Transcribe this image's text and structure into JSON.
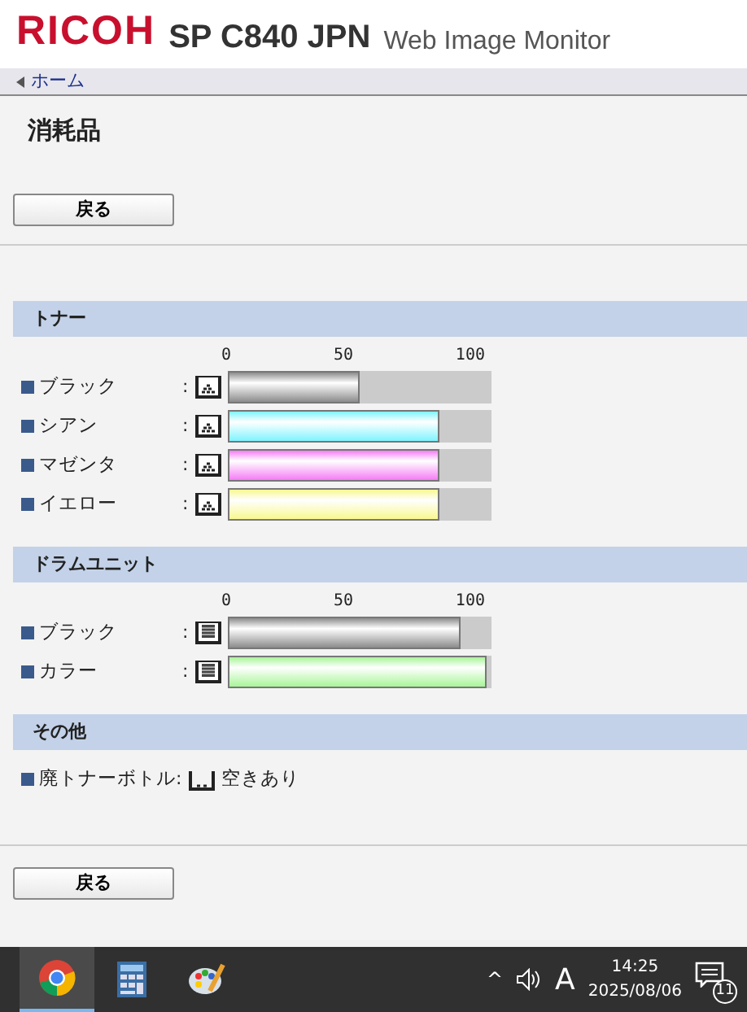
{
  "header": {
    "brand": "RICOH",
    "model": "SP C840 JPN",
    "product": "Web Image Monitor"
  },
  "breadcrumb": {
    "label": "ホーム"
  },
  "title": "消耗品",
  "top_button": {
    "label": "戻る"
  },
  "sections": [
    {
      "title": "トナー",
      "kind": "toner",
      "scale": [
        "0",
        "50",
        "100"
      ],
      "items": [
        {
          "name": "ブラック",
          "separator": ":",
          "level": 0.5,
          "color": "#8c8c8c"
        },
        {
          "name": "シアン",
          "separator": ":",
          "level": 0.8,
          "color": "#7ff4ff"
        },
        {
          "name": "マゼンタ",
          "separator": ":",
          "level": 0.8,
          "color": "#f57cf5"
        },
        {
          "name": "イエロー",
          "separator": ":",
          "level": 0.8,
          "color": "#f8f890"
        }
      ]
    },
    {
      "title": "ドラムユニット",
      "kind": "drum",
      "scale": [
        "0",
        "50",
        "100"
      ],
      "items": [
        {
          "name": "ブラック",
          "separator": ":",
          "level": 0.88,
          "color": "#8c8c8c"
        },
        {
          "name": "カラー",
          "separator": ":",
          "level": 0.98,
          "color": "#a8f598"
        }
      ]
    },
    {
      "title": "その他",
      "kind": "status",
      "items": [
        {
          "name": "廃トナーボトル",
          "separator": ":",
          "status": "空きあり"
        }
      ]
    }
  ],
  "bottom_button": {
    "label": "戻る"
  },
  "taskbar": {
    "apps": [
      {
        "selected": true
      },
      {
        "selected": false
      },
      {
        "selected": false
      }
    ],
    "tray": {
      "caret": "^",
      "ime": "A",
      "time": "14:25",
      "date": "2025/08/06",
      "notifications": "11"
    }
  }
}
